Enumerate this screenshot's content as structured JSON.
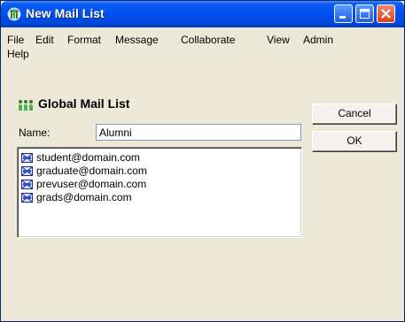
{
  "window": {
    "title": "New Mail List",
    "icon": "lotus-people-icon"
  },
  "menubar": {
    "items": [
      "File",
      "Edit",
      "Format",
      "Message",
      "Collaborate",
      "View",
      "Admin",
      "Help"
    ]
  },
  "form": {
    "heading": "Global Mail List",
    "name_label": "Name:",
    "name_value": "Alumni",
    "members": [
      "student@domain.com",
      "graduate@domain.com",
      "prevuser@domain.com",
      "grads@domain.com"
    ]
  },
  "buttons": {
    "cancel": "Cancel",
    "ok": "OK"
  }
}
